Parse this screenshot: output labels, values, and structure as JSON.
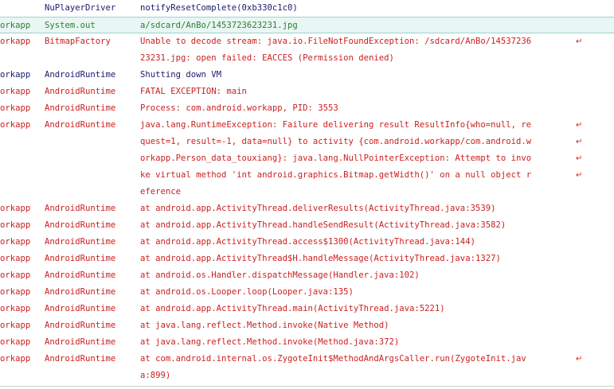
{
  "colors": {
    "verbose": "#1a1a6e",
    "info": "#2f7d2f",
    "error": "#cc1f1f",
    "highlight_bg": "#e8f6f4"
  },
  "wrap_icon": "line-wrap-icon",
  "wrap_glyph": "↵",
  "rows": [
    {
      "app": "",
      "tag": "NuPlayerDriver",
      "level": "verbose",
      "highlight": false,
      "lines": [
        "notifyResetComplete(0xb330c1c0)"
      ]
    },
    {
      "app": "orkapp",
      "tag": "System.out",
      "level": "info",
      "highlight": true,
      "lines": [
        "a/sdcard/AnBo/1453723623231.jpg"
      ]
    },
    {
      "app": "orkapp",
      "tag": "BitmapFactory",
      "level": "error",
      "highlight": false,
      "lines": [
        "Unable to decode stream: java.io.FileNotFoundException: /sdcard/AnBo/14537236",
        "23231.jpg: open failed: EACCES (Permission denied)"
      ]
    },
    {
      "app": "orkapp",
      "tag": "AndroidRuntime",
      "level": "verbose",
      "highlight": false,
      "lines": [
        "Shutting down VM"
      ]
    },
    {
      "app": "orkapp",
      "tag": "AndroidRuntime",
      "level": "error",
      "highlight": false,
      "lines": [
        "FATAL EXCEPTION: main"
      ]
    },
    {
      "app": "orkapp",
      "tag": "AndroidRuntime",
      "level": "error",
      "highlight": false,
      "lines": [
        "Process: com.android.workapp, PID: 3553"
      ]
    },
    {
      "app": "orkapp",
      "tag": "AndroidRuntime",
      "level": "error",
      "highlight": false,
      "lines": [
        "java.lang.RuntimeException: Failure delivering result ResultInfo{who=null, re",
        "quest=1, result=-1, data=null} to activity {com.android.workapp/com.android.w",
        "orkapp.Person_data_touxiang}: java.lang.NullPointerException: Attempt to invo",
        "ke virtual method 'int android.graphics.Bitmap.getWidth()' on a null object r",
        "eference"
      ]
    },
    {
      "app": "orkapp",
      "tag": "AndroidRuntime",
      "level": "error",
      "highlight": false,
      "lines": [
        "at android.app.ActivityThread.deliverResults(ActivityThread.java:3539)"
      ]
    },
    {
      "app": "orkapp",
      "tag": "AndroidRuntime",
      "level": "error",
      "highlight": false,
      "lines": [
        "at android.app.ActivityThread.handleSendResult(ActivityThread.java:3582)"
      ]
    },
    {
      "app": "orkapp",
      "tag": "AndroidRuntime",
      "level": "error",
      "highlight": false,
      "lines": [
        "at android.app.ActivityThread.access$1300(ActivityThread.java:144)"
      ]
    },
    {
      "app": "orkapp",
      "tag": "AndroidRuntime",
      "level": "error",
      "highlight": false,
      "lines": [
        "at android.app.ActivityThread$H.handleMessage(ActivityThread.java:1327)"
      ]
    },
    {
      "app": "orkapp",
      "tag": "AndroidRuntime",
      "level": "error",
      "highlight": false,
      "lines": [
        "at android.os.Handler.dispatchMessage(Handler.java:102)"
      ]
    },
    {
      "app": "orkapp",
      "tag": "AndroidRuntime",
      "level": "error",
      "highlight": false,
      "lines": [
        "at android.os.Looper.loop(Looper.java:135)"
      ]
    },
    {
      "app": "orkapp",
      "tag": "AndroidRuntime",
      "level": "error",
      "highlight": false,
      "lines": [
        "at android.app.ActivityThread.main(ActivityThread.java:5221)"
      ]
    },
    {
      "app": "orkapp",
      "tag": "AndroidRuntime",
      "level": "error",
      "highlight": false,
      "lines": [
        "at java.lang.reflect.Method.invoke(Native Method)"
      ]
    },
    {
      "app": "orkapp",
      "tag": "AndroidRuntime",
      "level": "error",
      "highlight": false,
      "lines": [
        "at java.lang.reflect.Method.invoke(Method.java:372)"
      ]
    },
    {
      "app": "orkapp",
      "tag": "AndroidRuntime",
      "level": "error",
      "highlight": false,
      "lines": [
        "at com.android.internal.os.ZygoteInit$MethodAndArgsCaller.run(ZygoteInit.jav",
        "a:899)"
      ]
    }
  ]
}
